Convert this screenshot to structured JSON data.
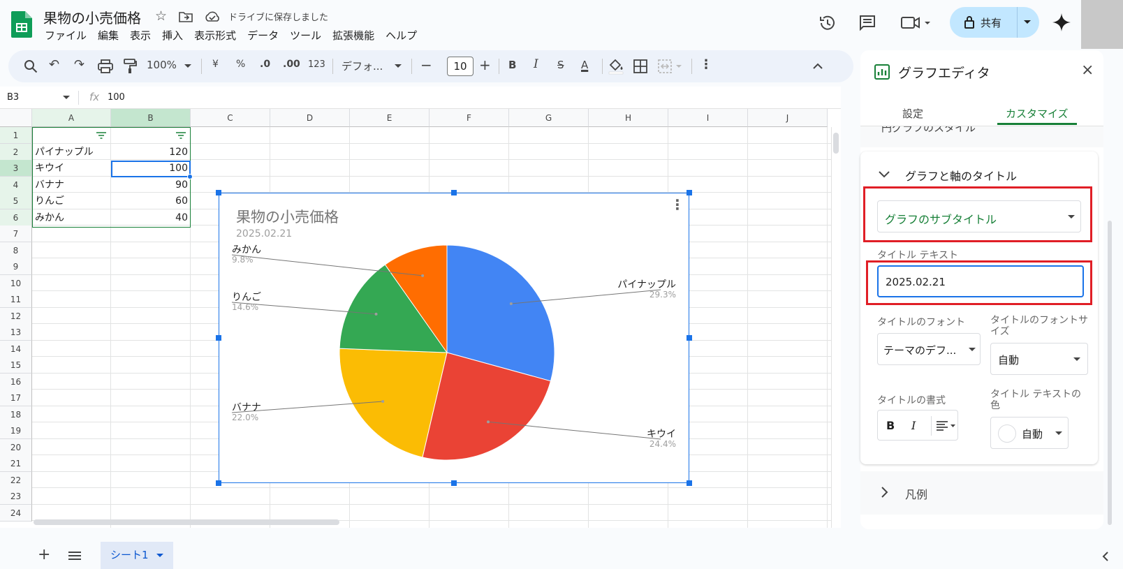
{
  "app": {
    "doc_title": "果物の小売価格",
    "saved_status": "ドライブに保存しました",
    "menu": [
      "ファイル",
      "編集",
      "表示",
      "挿入",
      "表示形式",
      "データ",
      "ツール",
      "拡張機能",
      "ヘルプ"
    ],
    "share_label": "共有"
  },
  "toolbar": {
    "zoom": "100%",
    "currency": "¥",
    "percent": "%",
    "dec_decrease": ".0",
    "dec_increase": ".00",
    "number_format": "123",
    "font": "デフォ...",
    "font_size": "10"
  },
  "formula_bar": {
    "cell_ref": "B3",
    "fx": "fx",
    "value": "100"
  },
  "grid": {
    "columns": [
      "A",
      "B",
      "C",
      "D",
      "E",
      "F",
      "G",
      "H",
      "I",
      "J"
    ],
    "rows": [
      "1",
      "2",
      "3",
      "4",
      "5",
      "6",
      "7",
      "8",
      "9",
      "10",
      "11",
      "12",
      "13",
      "14",
      "15",
      "16",
      "17",
      "18",
      "19",
      "20",
      "21",
      "22",
      "23",
      "24"
    ],
    "data": [
      {
        "name": "パイナップル",
        "value": "120"
      },
      {
        "name": "キウイ",
        "value": "100"
      },
      {
        "name": "バナナ",
        "value": "90"
      },
      {
        "name": "りんご",
        "value": "60"
      },
      {
        "name": "みかん",
        "value": "40"
      }
    ]
  },
  "chart_data": {
    "type": "pie",
    "title": "果物の小売価格",
    "subtitle": "2025.02.21",
    "categories": [
      "パイナップル",
      "キウイ",
      "バナナ",
      "りんご",
      "みかん"
    ],
    "values": [
      120,
      100,
      90,
      60,
      40
    ],
    "percent_labels": [
      "29.3%",
      "24.4%",
      "22.0%",
      "14.6%",
      "9.8%"
    ],
    "colors": [
      "#4285f4",
      "#ea4335",
      "#fbbc04",
      "#34a853",
      "#ff6d01"
    ]
  },
  "panel": {
    "title": "グラフエディタ",
    "tabs": [
      "設定",
      "カスタマイズ"
    ],
    "section_chart_style_partial": "円グラフのスタイル",
    "section_titles": "グラフと軸のタイトル",
    "title_type_selected": "グラフのサブタイトル",
    "title_text_label": "タイトル テキスト",
    "title_text_value": "2025.02.21",
    "title_font_label": "タイトルのフォント",
    "title_font_value": "テーマのデフ...",
    "title_font_size_label": "タイトルのフォントサイズ",
    "title_font_size_value": "自動",
    "title_format_label": "タイトルの書式",
    "title_color_label": "タイトル テキストの色",
    "title_color_value": "自動",
    "section_legend": "凡例"
  },
  "bottom": {
    "sheet_name": "シート1"
  },
  "colors": {
    "accent_green": "#188038",
    "selection_blue": "#1a73e8",
    "highlight_red": "#e01e26"
  }
}
